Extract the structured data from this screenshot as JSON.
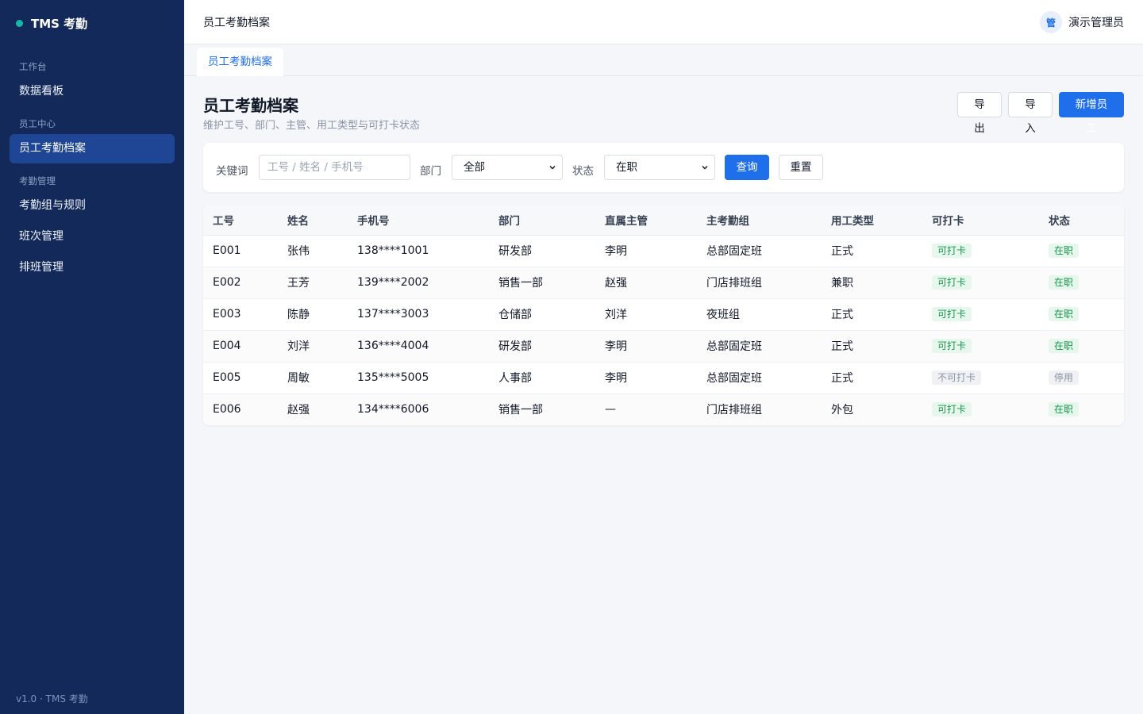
{
  "app": {
    "brand": "TMS 考勤",
    "version": "v1.0 · TMS 考勤"
  },
  "sidebar": {
    "groups": [
      {
        "label": "工作台",
        "items": [
          {
            "label": "数据看板",
            "active": false
          }
        ]
      },
      {
        "label": "员工中心",
        "items": [
          {
            "label": "员工考勤档案",
            "active": true
          }
        ]
      },
      {
        "label": "考勤管理",
        "items": [
          {
            "label": "考勤组与规则",
            "active": false
          },
          {
            "label": "班次管理",
            "active": false
          },
          {
            "label": "排班管理",
            "active": false
          }
        ]
      }
    ]
  },
  "header": {
    "title": "员工考勤档案",
    "avatar_text": "管",
    "user_name": "演示管理员"
  },
  "tabs": [
    {
      "label": "员工考勤档案",
      "active": true
    }
  ],
  "page": {
    "title": "员工考勤档案",
    "subtitle": "维护工号、部门、主管、用工类型与可打卡状态",
    "actions": {
      "export": "导出",
      "import": "导入",
      "add": "新增员工"
    }
  },
  "filters": {
    "keyword_label": "关键词",
    "keyword_placeholder": "工号 / 姓名 / 手机号",
    "keyword_value": "",
    "dept_label": "部门",
    "dept_value": "全部",
    "status_label": "状态",
    "status_value": "在职",
    "query": "查询",
    "reset": "重置"
  },
  "table": {
    "columns": [
      "工号",
      "姓名",
      "手机号",
      "部门",
      "直属主管",
      "主考勤组",
      "用工类型",
      "可打卡",
      "状态"
    ],
    "rows": [
      {
        "id": "E001",
        "name": "张伟",
        "phone": "138****1001",
        "dept": "研发部",
        "manager": "李明",
        "group": "总部固定班",
        "type": "正式",
        "clock": "可打卡",
        "clock_ok": true,
        "status": "在职",
        "status_ok": true
      },
      {
        "id": "E002",
        "name": "王芳",
        "phone": "139****2002",
        "dept": "销售一部",
        "manager": "赵强",
        "group": "门店排班组",
        "type": "兼职",
        "clock": "可打卡",
        "clock_ok": true,
        "status": "在职",
        "status_ok": true
      },
      {
        "id": "E003",
        "name": "陈静",
        "phone": "137****3003",
        "dept": "仓储部",
        "manager": "刘洋",
        "group": "夜班组",
        "type": "正式",
        "clock": "可打卡",
        "clock_ok": true,
        "status": "在职",
        "status_ok": true
      },
      {
        "id": "E004",
        "name": "刘洋",
        "phone": "136****4004",
        "dept": "研发部",
        "manager": "李明",
        "group": "总部固定班",
        "type": "正式",
        "clock": "可打卡",
        "clock_ok": true,
        "status": "在职",
        "status_ok": true
      },
      {
        "id": "E005",
        "name": "周敏",
        "phone": "135****5005",
        "dept": "人事部",
        "manager": "李明",
        "group": "总部固定班",
        "type": "正式",
        "clock": "不可打卡",
        "clock_ok": false,
        "status": "停用",
        "status_ok": false
      },
      {
        "id": "E006",
        "name": "赵强",
        "phone": "134****6006",
        "dept": "销售一部",
        "manager": "—",
        "group": "门店排班组",
        "type": "外包",
        "clock": "可打卡",
        "clock_ok": true,
        "status": "在职",
        "status_ok": true
      }
    ]
  },
  "colors": {
    "sidebar_bg": "#13295a",
    "sidebar_active": "#1e4694",
    "primary": "#1f6feb",
    "success": "#14964a",
    "brand_dot": "#14b8a6"
  }
}
